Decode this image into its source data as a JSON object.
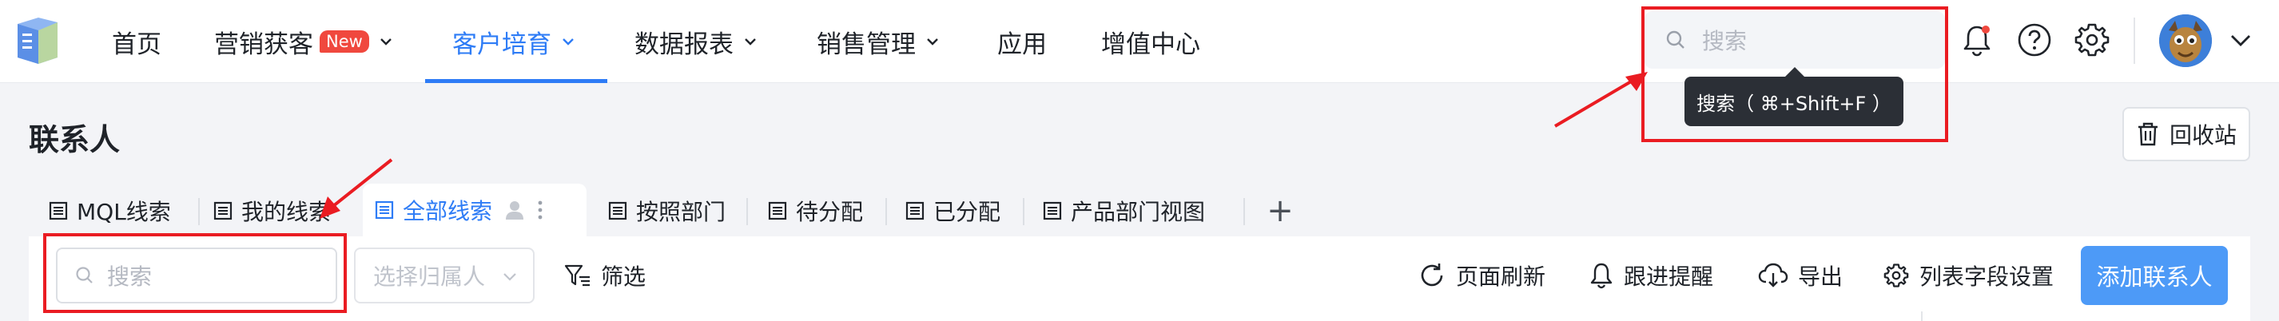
{
  "nav": {
    "items": [
      {
        "label": "首页"
      },
      {
        "label": "营销获客",
        "badge": "New"
      },
      {
        "label": "客户培育"
      },
      {
        "label": "数据报表"
      },
      {
        "label": "销售管理"
      },
      {
        "label": "应用"
      },
      {
        "label": "增值中心"
      }
    ],
    "active_index": 2,
    "accent_color": "#2e7cf6"
  },
  "top_search": {
    "placeholder": "搜索",
    "tooltip": "搜索（ ⌘+Shift+F ）"
  },
  "header_icons": [
    "bell-icon",
    "help-icon",
    "gear-icon",
    "avatar",
    "chevron-down-icon"
  ],
  "page": {
    "title": "联系人",
    "recycle_label": "回收站"
  },
  "tabs": [
    {
      "label": "MQL线索"
    },
    {
      "label": "我的线索"
    },
    {
      "label": "全部线索"
    },
    {
      "label": "按照部门"
    },
    {
      "label": "待分配"
    },
    {
      "label": "已分配"
    },
    {
      "label": "产品部门视图"
    }
  ],
  "active_tab_index": 2,
  "toolbar": {
    "search_placeholder": "搜索",
    "owner_placeholder": "选择归属人",
    "filter_label": "筛选",
    "refresh_label": "页面刷新",
    "reminder_label": "跟进提醒",
    "export_label": "导出",
    "columns_label": "列表字段设置",
    "add_label": "添加联系人"
  },
  "colors": {
    "highlight_red": "#ea1c22",
    "primary_button": "#4d9af7",
    "tooltip_bg": "#2b2f36",
    "badge_red": "#f0483e"
  }
}
